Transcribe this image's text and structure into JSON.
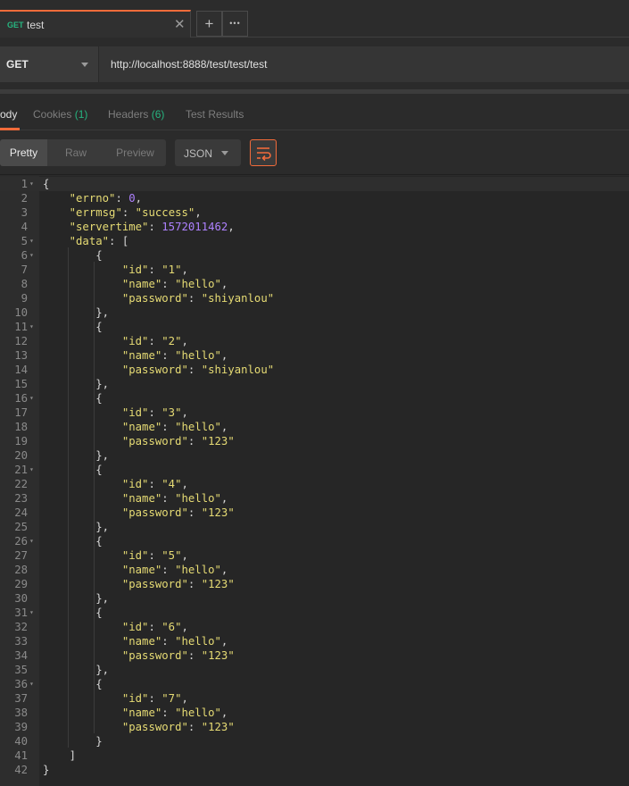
{
  "tab": {
    "method": "GET",
    "name": "test",
    "close": "✕",
    "add": "+",
    "more": "•••"
  },
  "request": {
    "method": "GET",
    "url": "http://localhost:8888/test/test/test"
  },
  "response_tabs": {
    "body": "ody",
    "cookies": "Cookies",
    "cookies_count": "(1)",
    "headers": "Headers",
    "headers_count": "(6)",
    "tests": "Test Results"
  },
  "view": {
    "pretty": "Pretty",
    "raw": "Raw",
    "preview": "Preview",
    "format": "JSON"
  },
  "code_lines": [
    "{",
    "    \"errno\": 0,",
    "    \"errmsg\": \"success\",",
    "    \"servertime\": 1572011462,",
    "    \"data\": [",
    "        {",
    "            \"id\": \"1\",",
    "            \"name\": \"hello\",",
    "            \"password\": \"shiyanlou\"",
    "        },",
    "        {",
    "            \"id\": \"2\",",
    "            \"name\": \"hello\",",
    "            \"password\": \"shiyanlou\"",
    "        },",
    "        {",
    "            \"id\": \"3\",",
    "            \"name\": \"hello\",",
    "            \"password\": \"123\"",
    "        },",
    "        {",
    "            \"id\": \"4\",",
    "            \"name\": \"hello\",",
    "            \"password\": \"123\"",
    "        },",
    "        {",
    "            \"id\": \"5\",",
    "            \"name\": \"hello\",",
    "            \"password\": \"123\"",
    "        },",
    "        {",
    "            \"id\": \"6\",",
    "            \"name\": \"hello\",",
    "            \"password\": \"123\"",
    "        },",
    "        {",
    "            \"id\": \"7\",",
    "            \"name\": \"hello\",",
    "            \"password\": \"123\"",
    "        }",
    "    ]",
    "}"
  ],
  "foldable_lines": [
    1,
    5,
    6,
    11,
    16,
    21,
    26,
    31,
    36
  ],
  "colors": {
    "accent": "#f26b3a",
    "count": "#26b47f",
    "string": "#e6db74",
    "number": "#ae81ff"
  }
}
